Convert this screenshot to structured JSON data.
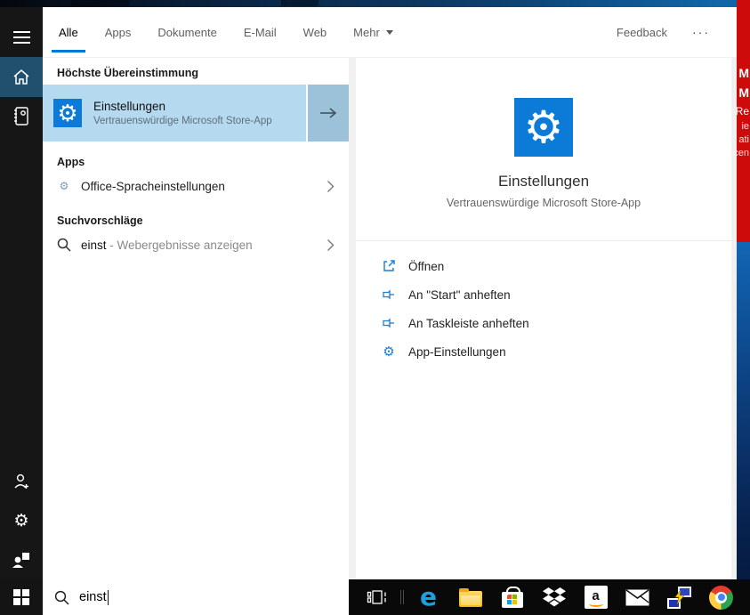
{
  "tabs": {
    "items": [
      {
        "label": "Alle"
      },
      {
        "label": "Apps"
      },
      {
        "label": "Dokumente"
      },
      {
        "label": "E-Mail"
      },
      {
        "label": "Web"
      },
      {
        "label": "Mehr"
      }
    ],
    "feedback": "Feedback",
    "more_options": "···"
  },
  "left_panel": {
    "best_match_header": "Höchste Übereinstimmung",
    "best_match": {
      "title": "Einstellungen",
      "subtitle": "Vertrauenswürdige Microsoft Store-App"
    },
    "apps_header": "Apps",
    "apps_item": "Office-Spracheinstellungen",
    "suggestions_header": "Suchvorschläge",
    "suggestion_query": "einst",
    "suggestion_suffix": " - Webergebnisse anzeigen"
  },
  "right_panel": {
    "title": "Einstellungen",
    "subtitle": "Vertrauenswürdige Microsoft Store-App",
    "actions": [
      {
        "label": "Öffnen"
      },
      {
        "label": "An \"Start\" anheften"
      },
      {
        "label": "An Taskleiste anheften"
      },
      {
        "label": "App-Einstellungen"
      }
    ]
  },
  "taskbar": {
    "search_value": "einst"
  },
  "background_fragments": [
    "M",
    "M",
    "Re",
    "ie",
    "ati",
    "cen"
  ],
  "colors": {
    "accent": "#0078d7",
    "tile_blue": "#0b7bd7",
    "highlight_row": "#b5daf0",
    "highlight_arrow": "#9cc2da",
    "rail_selected": "#20506e",
    "background_red": "#ce0b0b"
  }
}
